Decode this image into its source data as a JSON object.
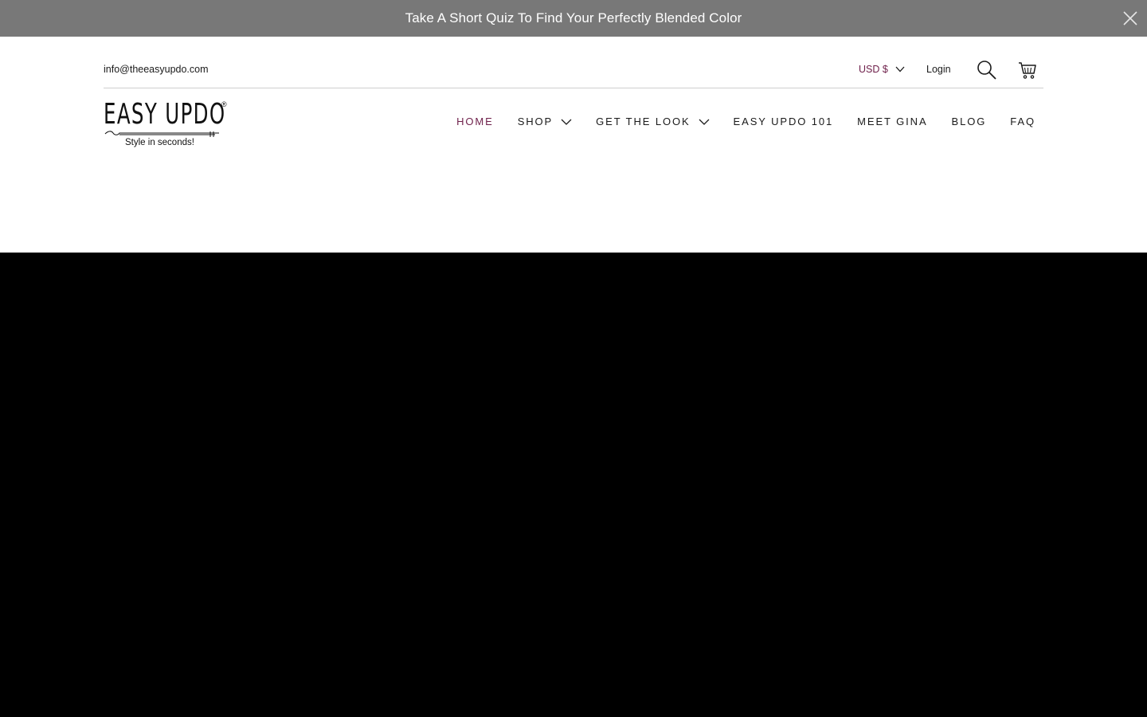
{
  "announcement": {
    "text": "Take A Short Quiz To Find Your Perfectly Blended Color",
    "close_icon": "close-icon"
  },
  "topbar": {
    "email": "info@theeasyupdo.com",
    "currency": "USD $",
    "login": "Login",
    "search_icon": "search-icon",
    "cart_icon": "cart-icon"
  },
  "logo": {
    "wordmark": "EASY UPDO",
    "registered": "®",
    "tagline": "Style in seconds!"
  },
  "nav": {
    "items": [
      {
        "label": "HOME",
        "active": true
      },
      {
        "label": "SHOP",
        "has_dropdown": true
      },
      {
        "label": "GET THE LOOK",
        "has_dropdown": true
      },
      {
        "label": "EASY UPDO 101"
      },
      {
        "label": "MEET GINA"
      },
      {
        "label": "BLOG"
      },
      {
        "label": "FAQ"
      }
    ]
  },
  "colors": {
    "accent": "#6e1f4a",
    "announcement_bg": "#787878",
    "hero_bg": "#000000"
  }
}
